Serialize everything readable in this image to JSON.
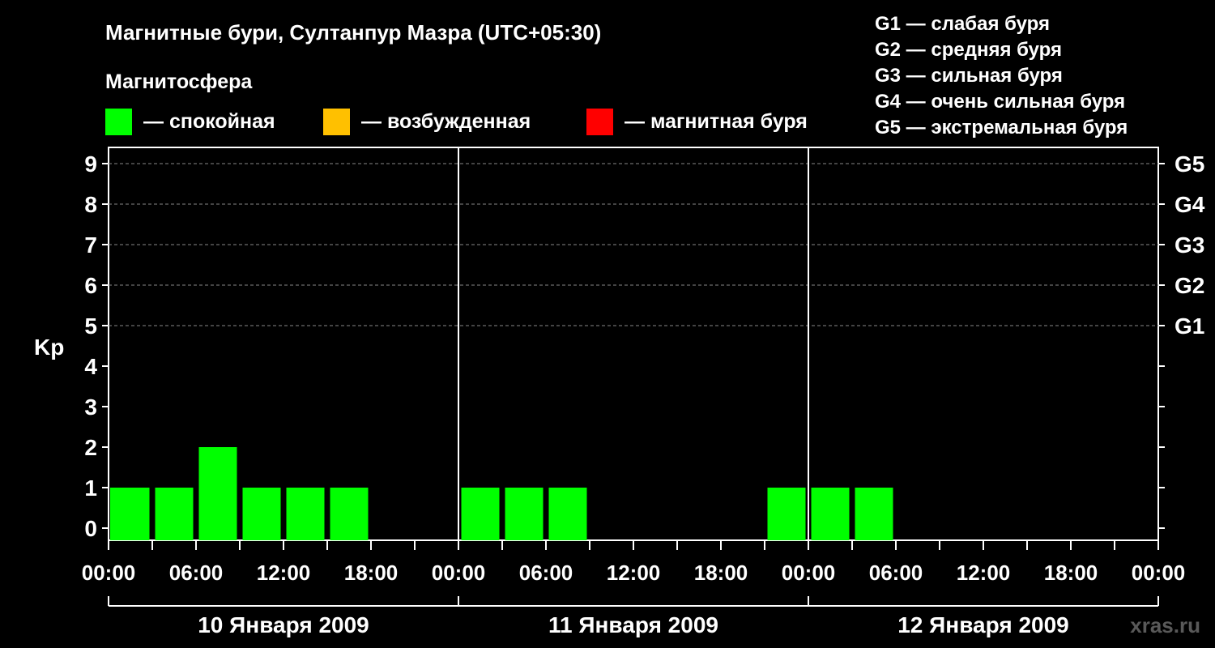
{
  "title": "Магнитные бури, Султанпур Мазра (UTC+05:30)",
  "legend": {
    "heading": "Магнитосфера",
    "items": [
      {
        "label": "— спокойная",
        "color": "#00ff00"
      },
      {
        "label": "— возбужденная",
        "color": "#ffc000"
      },
      {
        "label": "— магнитная буря",
        "color": "#ff0000"
      }
    ]
  },
  "g_scale": [
    "G1 — слабая буря",
    "G2 — средняя буря",
    "G3 — сильная буря",
    "G4 — очень сильная буря",
    "G5 — экстремальная буря"
  ],
  "watermark": "xras.ru",
  "chart_data": {
    "type": "bar",
    "ylabel": "Kp",
    "ylim": [
      0,
      9
    ],
    "yticks": [
      "0",
      "1",
      "2",
      "3",
      "4",
      "5",
      "6",
      "7",
      "8",
      "9"
    ],
    "right_ticks": [
      {
        "kp": 5,
        "label": "G1"
      },
      {
        "kp": 6,
        "label": "G2"
      },
      {
        "kp": 7,
        "label": "G3"
      },
      {
        "kp": 8,
        "label": "G4"
      },
      {
        "kp": 9,
        "label": "G5"
      }
    ],
    "x_tick_labels": [
      "00:00",
      "06:00",
      "12:00",
      "18:00",
      "00:00",
      "06:00",
      "12:00",
      "18:00",
      "00:00",
      "06:00",
      "12:00",
      "18:00",
      "00:00"
    ],
    "days": [
      "10 Января 2009",
      "11 Января 2009",
      "12 Января 2009"
    ],
    "grid": true,
    "series": [
      {
        "values": [
          {
            "start": "10 Января 2009 00:00",
            "kp": 1
          },
          {
            "start": "10 Января 2009 03:00",
            "kp": 1
          },
          {
            "start": "10 Января 2009 06:00",
            "kp": 2
          },
          {
            "start": "10 Января 2009 09:00",
            "kp": 1
          },
          {
            "start": "10 Января 2009 12:00",
            "kp": 1
          },
          {
            "start": "10 Января 2009 15:00",
            "kp": 1
          },
          {
            "start": "11 Января 2009 00:00",
            "kp": 1
          },
          {
            "start": "11 Января 2009 03:00",
            "kp": 1
          },
          {
            "start": "11 Января 2009 06:00",
            "kp": 1
          },
          {
            "start": "11 Января 2009 21:00",
            "kp": 1
          },
          {
            "start": "12 Января 2009 00:00",
            "kp": 1
          },
          {
            "start": "12 Января 2009 03:00",
            "kp": 1
          }
        ]
      }
    ]
  }
}
